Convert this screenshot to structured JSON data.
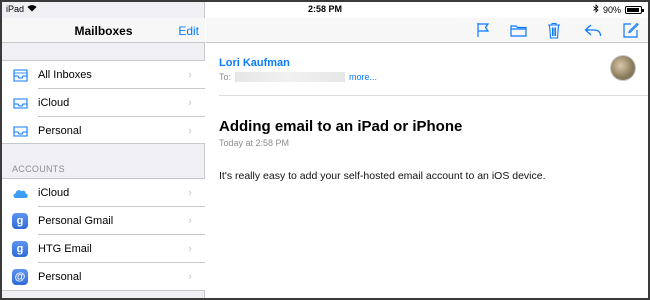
{
  "status": {
    "device": "iPad",
    "time": "2:58 PM",
    "battery": "90%"
  },
  "sidebar": {
    "title": "Mailboxes",
    "edit_label": "Edit",
    "mailboxes": [
      {
        "label": "All Inboxes",
        "icon": "inbox-icon"
      },
      {
        "label": "iCloud",
        "icon": "inbox-icon"
      },
      {
        "label": "Personal",
        "icon": "inbox-icon"
      }
    ],
    "accounts_header": "ACCOUNTS",
    "accounts": [
      {
        "label": "iCloud",
        "icon": "icloud-icon"
      },
      {
        "label": "Personal Gmail",
        "icon": "gmail-icon"
      },
      {
        "label": "HTG Email",
        "icon": "gmail-icon"
      },
      {
        "label": "Personal",
        "icon": "at-icon"
      }
    ]
  },
  "message": {
    "sender": "Lori Kaufman",
    "to_label": "To:",
    "more_label": "more...",
    "subject": "Adding email to an iPad or iPhone",
    "date": "Today at 2:58 PM",
    "body": "It's really easy to add your self-hosted email account to an iOS device."
  },
  "colors": {
    "accent": "#0a7aff",
    "sidebar_bg": "#efeff4"
  }
}
